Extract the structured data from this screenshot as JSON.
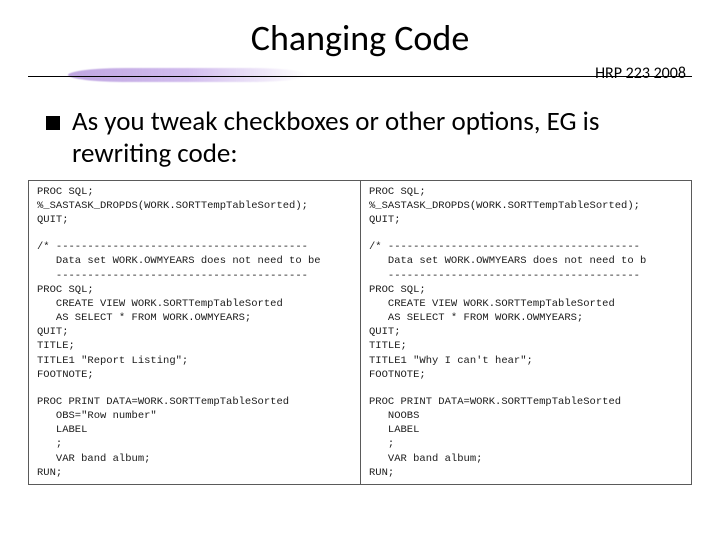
{
  "title": "Changing Code",
  "course": "HRP 223 2008",
  "bullet_text": "As you tweak checkboxes or other options, EG is rewriting code:",
  "code_left": [
    "PROC SQL;",
    "%_SASTASK_DROPDS(WORK.SORTTempTableSorted);",
    "QUIT;",
    "",
    "/* ----------------------------------------",
    "   Data set WORK.OWMYEARS does not need to be",
    "   ----------------------------------------",
    "PROC SQL;",
    "   CREATE VIEW WORK.SORTTempTableSorted",
    "   AS SELECT * FROM WORK.OWMYEARS;",
    "QUIT;",
    "TITLE;",
    "TITLE1 \"Report Listing\";",
    "FOOTNOTE;",
    "",
    "PROC PRINT DATA=WORK.SORTTempTableSorted",
    "   OBS=\"Row number\"",
    "   LABEL",
    "   ;",
    "   VAR band album;",
    "RUN;"
  ],
  "code_right": [
    "PROC SQL;",
    "%_SASTASK_DROPDS(WORK.SORTTempTableSorted);",
    "QUIT;",
    "",
    "/* ----------------------------------------",
    "   Data set WORK.OWMYEARS does not need to b",
    "   ----------------------------------------",
    "PROC SQL;",
    "   CREATE VIEW WORK.SORTTempTableSorted",
    "   AS SELECT * FROM WORK.OWMYEARS;",
    "QUIT;",
    "TITLE;",
    "TITLE1 \"Why I can't hear\";",
    "FOOTNOTE;",
    "",
    "PROC PRINT DATA=WORK.SORTTempTableSorted",
    "   NOOBS",
    "   LABEL",
    "   ;",
    "   VAR band album;",
    "RUN;"
  ]
}
